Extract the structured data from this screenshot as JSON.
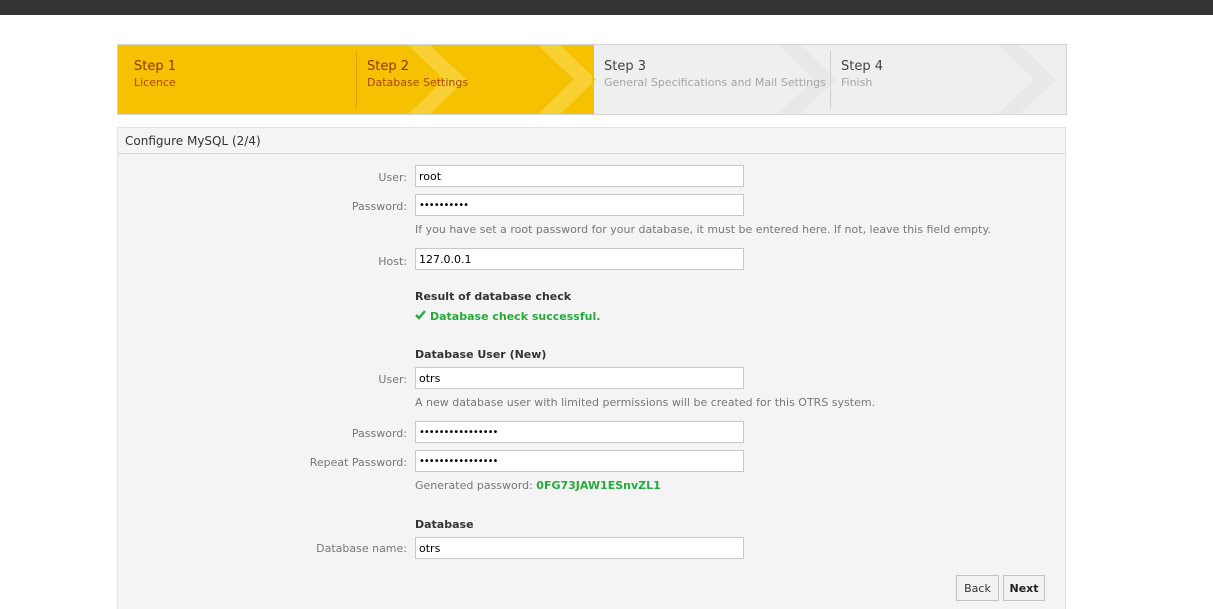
{
  "steps": [
    {
      "title": "Step 1",
      "subtitle": "Licence"
    },
    {
      "title": "Step 2",
      "subtitle": "Database Settings"
    },
    {
      "title": "Step 3",
      "subtitle": "General Specifications and Mail Settings"
    },
    {
      "title": "Step 4",
      "subtitle": "Finish"
    }
  ],
  "panel": {
    "title": "Configure MySQL (2/4)"
  },
  "form": {
    "user_label": "User:",
    "user_value": "root",
    "password_label": "Password:",
    "password_value": "••••••••••",
    "password_hint": "If you have set a root password for your database, it must be entered here. If not, leave this field empty.",
    "host_label": "Host:",
    "host_value": "127.0.0.1",
    "check_heading": "Result of database check",
    "check_icon": "checkmark-icon",
    "check_result": "Database check successful.",
    "new_user_heading": "Database User (New)",
    "new_user_label": "User:",
    "new_user_value": "otrs",
    "new_user_hint": "A new database user with limited permissions will be created for this OTRS system.",
    "new_password_label": "Password:",
    "new_password_value": "••••••••••••••••",
    "repeat_password_label": "Repeat Password:",
    "repeat_password_value": "••••••••••••••••",
    "generated_label": "Generated password:",
    "generated_value": "0FG73JAW1ESnvZL1",
    "database_heading": "Database",
    "database_name_label": "Database name:",
    "database_name_value": "otrs"
  },
  "buttons": {
    "back": "Back",
    "next": "Next"
  },
  "colors": {
    "active_step": "#f6c100",
    "success": "#27a83a",
    "topbar": "#333333"
  }
}
